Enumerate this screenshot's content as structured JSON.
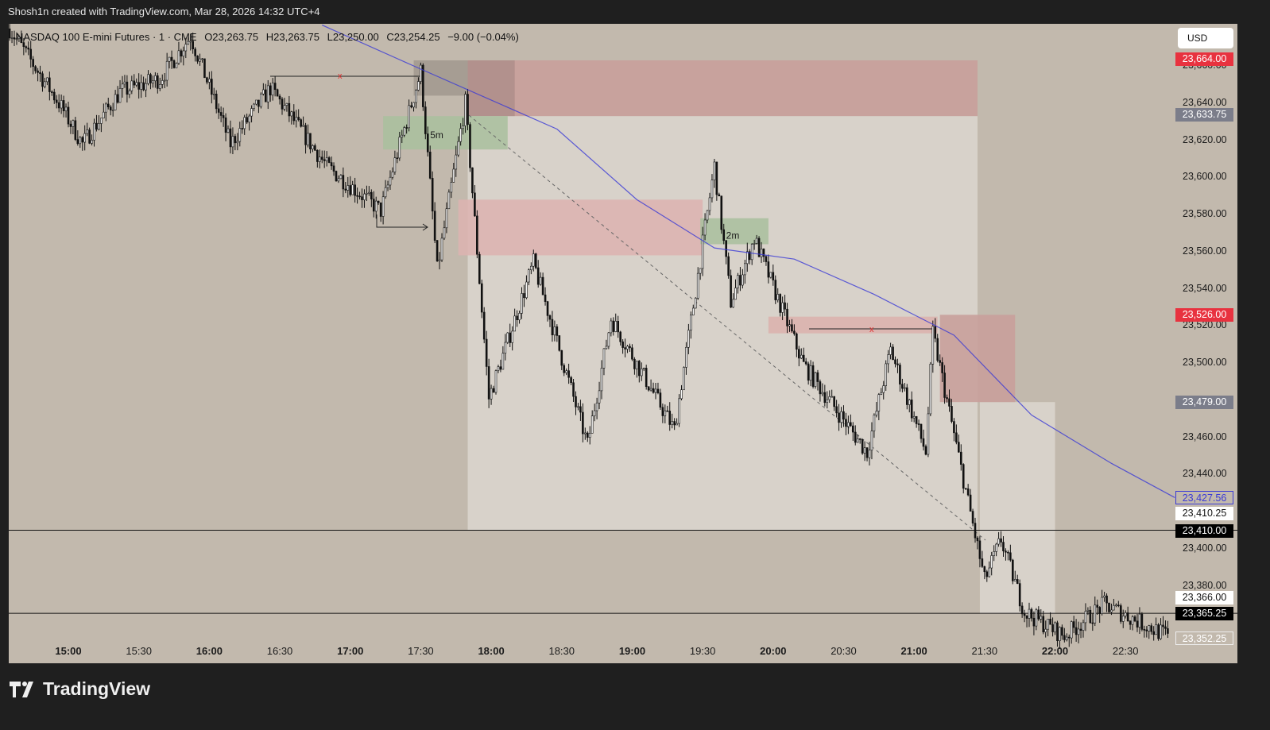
{
  "header": {
    "attribution": "Shosh1n created with TradingView.com, Mar 28, 2026 14:32 UTC+4"
  },
  "legend": {
    "symbol": "NASDAQ 100 E-mini Futures · 1 · CME",
    "open": "O23,263.75",
    "high": "H23,263.75",
    "low": "L23,250.00",
    "close": "C23,254.25",
    "change": "−9.00 (−0.04%)"
  },
  "currency": "USD",
  "footer": {
    "brand": "TradingView"
  },
  "colors": {
    "bg": "#c2b9ad",
    "red_badge": "#e8323f",
    "gray_badge": "#7b7d8a",
    "ma": "#3a3ad6",
    "zone_red": "#c9a09b",
    "zone_green": "#a9bf9e",
    "zone_light": "#d8d2ca"
  },
  "zone_labels": {
    "z5m": "5m",
    "z2m": "2m"
  },
  "sweep_marks": {
    "a": "x",
    "b": "x"
  },
  "chart_data": {
    "type": "candlestick",
    "title": "NASDAQ 100 E-mini Futures · 1 · CME",
    "interval_minutes": 1,
    "ylim": [
      23340,
      23690
    ],
    "y_ticks": [
      "23,660.00",
      "23,640.00",
      "23,620.00",
      "23,600.00",
      "23,580.00",
      "23,560.00",
      "23,540.00",
      "23,520.00",
      "23,500.00",
      "23,460.00",
      "23,440.00",
      "23,400.00",
      "23,380.00"
    ],
    "x_ticks": [
      {
        "label": "15:00",
        "bold": true
      },
      {
        "label": "15:30",
        "bold": false
      },
      {
        "label": "16:00",
        "bold": true
      },
      {
        "label": "16:30",
        "bold": false
      },
      {
        "label": "17:00",
        "bold": true
      },
      {
        "label": "17:30",
        "bold": false
      },
      {
        "label": "18:00",
        "bold": true
      },
      {
        "label": "18:30",
        "bold": false
      },
      {
        "label": "19:00",
        "bold": true
      },
      {
        "label": "19:30",
        "bold": false
      },
      {
        "label": "20:00",
        "bold": true
      },
      {
        "label": "20:30",
        "bold": false
      },
      {
        "label": "21:00",
        "bold": true
      },
      {
        "label": "21:30",
        "bold": false
      },
      {
        "label": "22:00",
        "bold": true
      },
      {
        "label": "22:30",
        "bold": false
      }
    ],
    "price_badges": [
      {
        "label": "23,664.00",
        "price": 23664,
        "style": "red"
      },
      {
        "label": "23,633.75",
        "price": 23633.75,
        "style": "gray"
      },
      {
        "label": "23,526.00",
        "price": 23526,
        "style": "red"
      },
      {
        "label": "23,479.00",
        "price": 23479,
        "style": "gray"
      },
      {
        "label": "23,427.56",
        "price": 23427.56,
        "style": "ma"
      },
      {
        "label": "23,410.25",
        "price": 23419,
        "style": "white"
      },
      {
        "label": "23,410.00",
        "price": 23410,
        "style": "black"
      },
      {
        "label": "23,366.00",
        "price": 23374,
        "style": "white"
      },
      {
        "label": "23,365.25",
        "price": 23365.25,
        "style": "black"
      },
      {
        "label": "23,352.25",
        "price": 23352.25,
        "style": "outline"
      }
    ],
    "horizontal_levels": [
      23410,
      23365.25
    ],
    "price_path": [
      {
        "t": "14:35",
        "p": 23680
      },
      {
        "t": "14:56",
        "p": 23640
      },
      {
        "t": "15:06",
        "p": 23618
      },
      {
        "t": "15:22",
        "p": 23646
      },
      {
        "t": "15:39",
        "p": 23653
      },
      {
        "t": "15:52",
        "p": 23676
      },
      {
        "t": "16:09",
        "p": 23618
      },
      {
        "t": "16:26",
        "p": 23648
      },
      {
        "t": "16:50",
        "p": 23606
      },
      {
        "t": "17:13",
        "p": 23582
      },
      {
        "t": "17:30",
        "p": 23657
      },
      {
        "t": "17:37",
        "p": 23550
      },
      {
        "t": "17:49",
        "p": 23640
      },
      {
        "t": "17:59",
        "p": 23481
      },
      {
        "t": "18:18",
        "p": 23554
      },
      {
        "t": "18:41",
        "p": 23456
      },
      {
        "t": "18:51",
        "p": 23524
      },
      {
        "t": "19:18",
        "p": 23464
      },
      {
        "t": "19:35",
        "p": 23606
      },
      {
        "t": "19:42",
        "p": 23533
      },
      {
        "t": "19:52",
        "p": 23567
      },
      {
        "t": "20:13",
        "p": 23499
      },
      {
        "t": "20:40",
        "p": 23452
      },
      {
        "t": "20:50",
        "p": 23507
      },
      {
        "t": "21:05",
        "p": 23452
      },
      {
        "t": "21:08",
        "p": 23516
      },
      {
        "t": "21:30",
        "p": 23383
      },
      {
        "t": "21:37",
        "p": 23405
      },
      {
        "t": "21:47",
        "p": 23366
      },
      {
        "t": "22:04",
        "p": 23353
      },
      {
        "t": "22:21",
        "p": 23370
      },
      {
        "t": "22:48",
        "p": 23353
      }
    ],
    "moving_average": [
      {
        "t": "16:48",
        "p": 23682
      },
      {
        "t": "17:27",
        "p": 23660
      },
      {
        "t": "18:28",
        "p": 23626
      },
      {
        "t": "19:02",
        "p": 23588
      },
      {
        "t": "19:35",
        "p": 23562
      },
      {
        "t": "20:09",
        "p": 23556
      },
      {
        "t": "20:43",
        "p": 23537
      },
      {
        "t": "21:17",
        "p": 23515
      },
      {
        "t": "21:50",
        "p": 23472
      },
      {
        "t": "22:24",
        "p": 23446
      },
      {
        "t": "22:51",
        "p": 23427.56
      }
    ]
  }
}
